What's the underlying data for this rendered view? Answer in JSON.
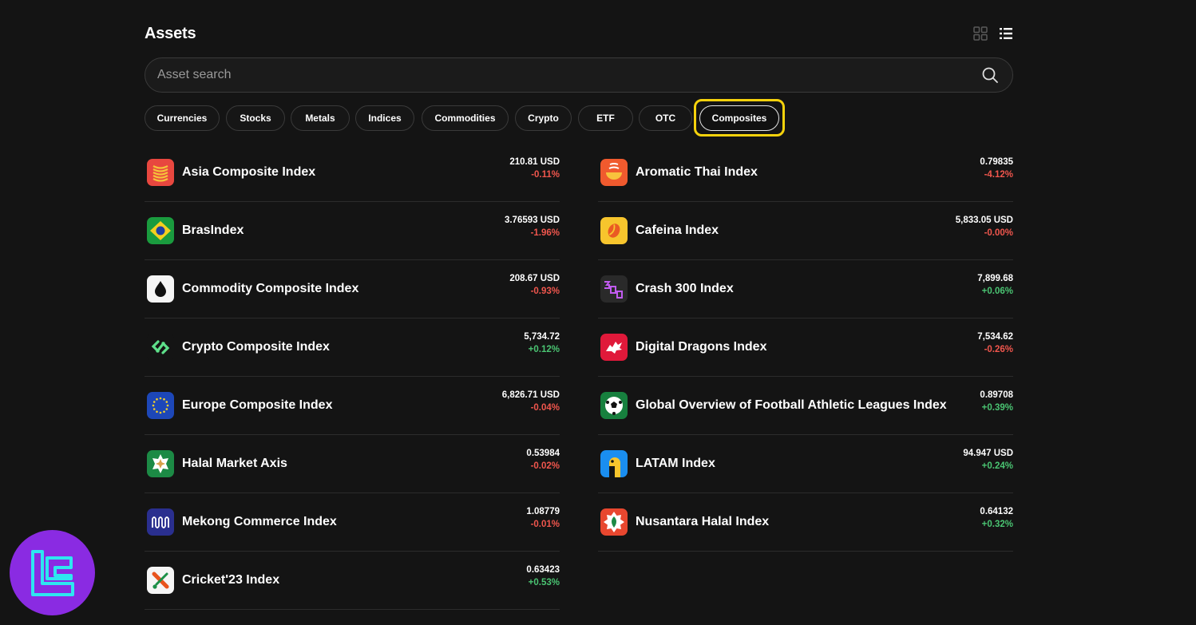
{
  "page": {
    "title": "Assets"
  },
  "search": {
    "placeholder": "Asset search"
  },
  "tabs": [
    {
      "label": "Currencies"
    },
    {
      "label": "Stocks"
    },
    {
      "label": "Metals"
    },
    {
      "label": "Indices"
    },
    {
      "label": "Commodities"
    },
    {
      "label": "Crypto"
    },
    {
      "label": "ETF"
    },
    {
      "label": "OTC"
    },
    {
      "label": "Composites",
      "active": true
    }
  ],
  "assets_left": [
    {
      "name": "Asia Composite Index",
      "price": "210.81 USD",
      "change": "-0.11%",
      "icon": "asia-icon"
    },
    {
      "name": "BrasIndex",
      "price": "3.76593 USD",
      "change": "-1.96%",
      "icon": "brazil-flag-icon"
    },
    {
      "name": "Commodity Composite Index",
      "price": "208.67 USD",
      "change": "-0.93%",
      "icon": "oil-drop-icon"
    },
    {
      "name": "Crypto Composite Index",
      "price": "5,734.72",
      "change": "+0.12%",
      "icon": "crypto-link-icon"
    },
    {
      "name": "Europe Composite Index",
      "price": "6,826.71 USD",
      "change": "-0.04%",
      "icon": "eu-stars-icon"
    },
    {
      "name": "Halal Market Axis",
      "price": "0.53984",
      "change": "-0.02%",
      "icon": "star-badge-icon"
    },
    {
      "name": "Mekong Commerce Index",
      "price": "1.08779",
      "change": "-0.01%",
      "icon": "wave-icon"
    },
    {
      "name": "Cricket'23 Index",
      "price": "0.63423",
      "change": "+0.53%",
      "icon": "cricket-bat-icon"
    }
  ],
  "assets_right": [
    {
      "name": "Aromatic Thai Index",
      "price": "0.79835",
      "change": "-4.12%",
      "icon": "thai-bowl-icon"
    },
    {
      "name": "Cafeina Index",
      "price": "5,833.05 USD",
      "change": "-0.00%",
      "icon": "coffee-bean-icon"
    },
    {
      "name": "Crash 300 Index",
      "price": "7,899.68",
      "change": "+0.06%",
      "icon": "crash-300-icon"
    },
    {
      "name": "Digital Dragons Index",
      "price": "7,534.62",
      "change": "-0.26%",
      "icon": "dragon-icon"
    },
    {
      "name": "Global Overview of Football Athletic Leagues Index",
      "price": "0.89708",
      "change": "+0.39%",
      "icon": "football-icon"
    },
    {
      "name": "LATAM Index",
      "price": "94.947 USD",
      "change": "+0.24%",
      "icon": "parrot-icon"
    },
    {
      "name": "Nusantara Halal Index",
      "price": "0.64132",
      "change": "+0.32%",
      "icon": "leaf-badge-icon"
    }
  ],
  "colors": {
    "negative": "#f0564d",
    "positive": "#4ac472",
    "highlight": "#f5d20c",
    "brand": "#8a2be2"
  }
}
